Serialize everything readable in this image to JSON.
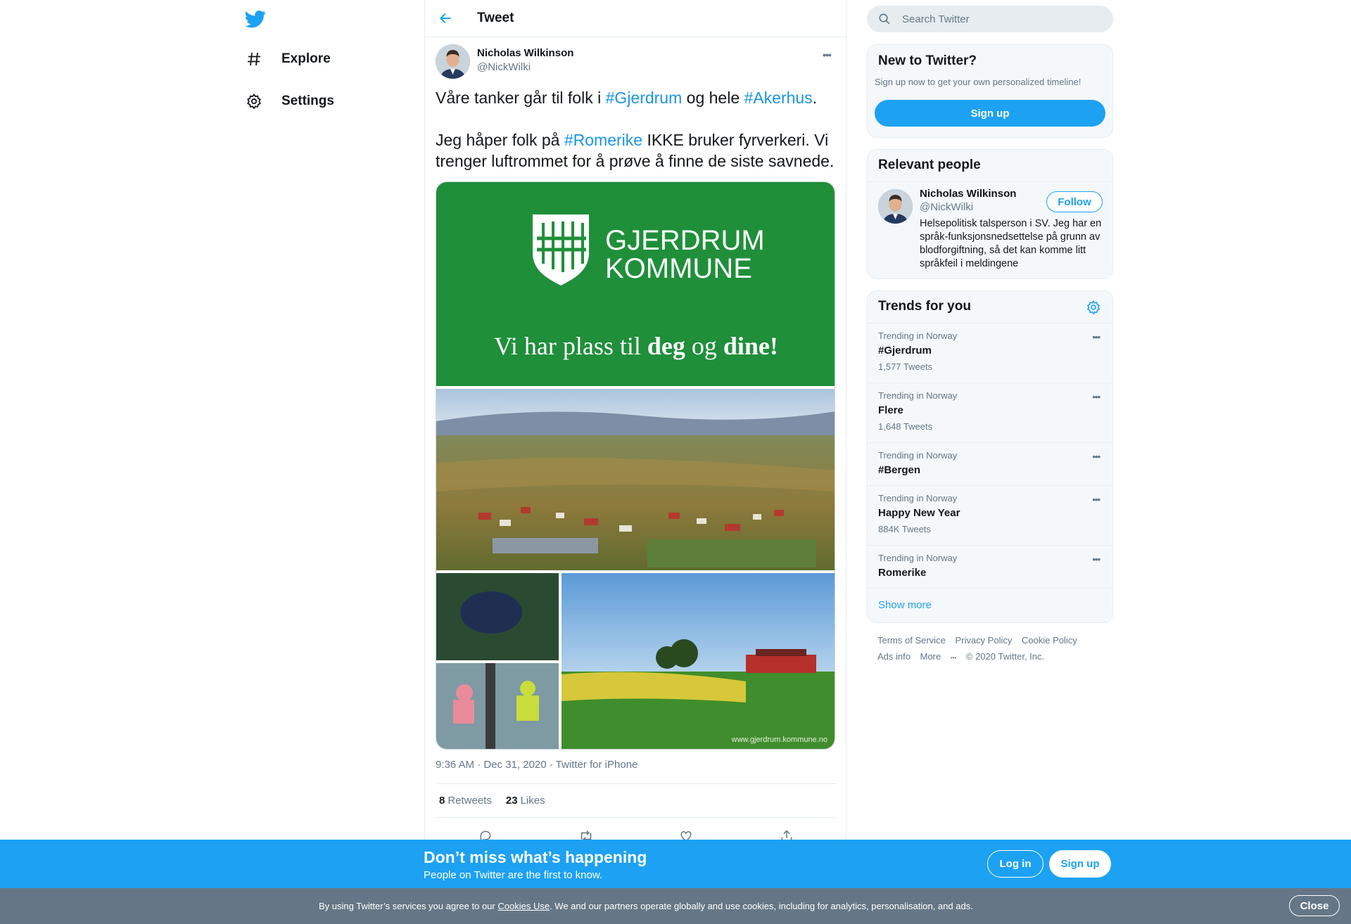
{
  "nav": {
    "items": [
      {
        "label": "Explore"
      },
      {
        "label": "Settings"
      }
    ]
  },
  "header": {
    "title": "Tweet"
  },
  "tweet": {
    "author_name": "Nicholas Wilkinson",
    "author_handle": "@NickWilki",
    "line1_pre": "Våre tanker går til folk i ",
    "line1_tag1": "#Gjerdrum",
    "line1_mid": " og hele ",
    "line1_tag2": "#Akerhus",
    "line1_post": ".",
    "line2_pre": "Jeg håper folk på ",
    "line2_tag": "#Romerike",
    "line2_post": " IKKE bruker fyrverkeri. Vi trenger luftrommet for å prøve å finne de siste savnede.",
    "media": {
      "brand_line1": "GJERDRUM",
      "brand_line2": "KOMMUNE",
      "slogan_pre": "Vi har plass til ",
      "slogan_b1": "deg",
      "slogan_mid": " og ",
      "slogan_b2": "dine!",
      "watermark": "www.gjerdrum.kommune.no"
    },
    "timestamp": "9:36 AM · Dec 31, 2020 · Twitter for iPhone",
    "retweets_count": "8",
    "retweets_label": "Retweets",
    "likes_count": "23",
    "likes_label": "Likes"
  },
  "search": {
    "placeholder": "Search Twitter"
  },
  "new_to_twitter": {
    "title": "New to Twitter?",
    "subtitle": "Sign up now to get your own personalized timeline!",
    "button": "Sign up"
  },
  "relevant_people": {
    "title": "Relevant people",
    "name": "Nicholas Wilkinson",
    "handle": "@NickWilki",
    "follow": "Follow",
    "bio": "Helsepolitisk talsperson i SV. Jeg har en språk-funksjonsnedsettelse på grunn av blodforgiftning, så det kan komme litt språkfeil i meldingene"
  },
  "trends": {
    "title": "Trends for you",
    "items": [
      {
        "context": "Trending in Norway",
        "name": "#Gjerdrum",
        "count": "1,577 Tweets"
      },
      {
        "context": "Trending in Norway",
        "name": "Flere",
        "count": "1,648 Tweets"
      },
      {
        "context": "Trending in Norway",
        "name": "#Bergen",
        "count": ""
      },
      {
        "context": "Trending in Norway",
        "name": "Happy New Year",
        "count": "884K Tweets"
      },
      {
        "context": "Trending in Norway",
        "name": "Romerike",
        "count": ""
      }
    ],
    "show_more": "Show more"
  },
  "footer": {
    "terms": "Terms of Service",
    "privacy": "Privacy Policy",
    "cookie": "Cookie Policy",
    "ads": "Ads info",
    "more": "More",
    "copyright": "© 2020 Twitter, Inc."
  },
  "banner": {
    "title": "Don’t miss what’s happening",
    "subtitle": "People on Twitter are the first to know.",
    "login": "Log in",
    "signup": "Sign up"
  },
  "cookie_bar": {
    "pre": "By using Twitter’s services you agree to our ",
    "link": "Cookies Use",
    "post": ". We and our partners operate globally and use cookies, including for analytics, personalisation, and ads.",
    "close": "Close"
  },
  "colors": {
    "brand": "#1da1f2",
    "hashtag": "#1b95e0",
    "secondary_text": "#657786",
    "municipal_green": "#1f8f3a"
  }
}
